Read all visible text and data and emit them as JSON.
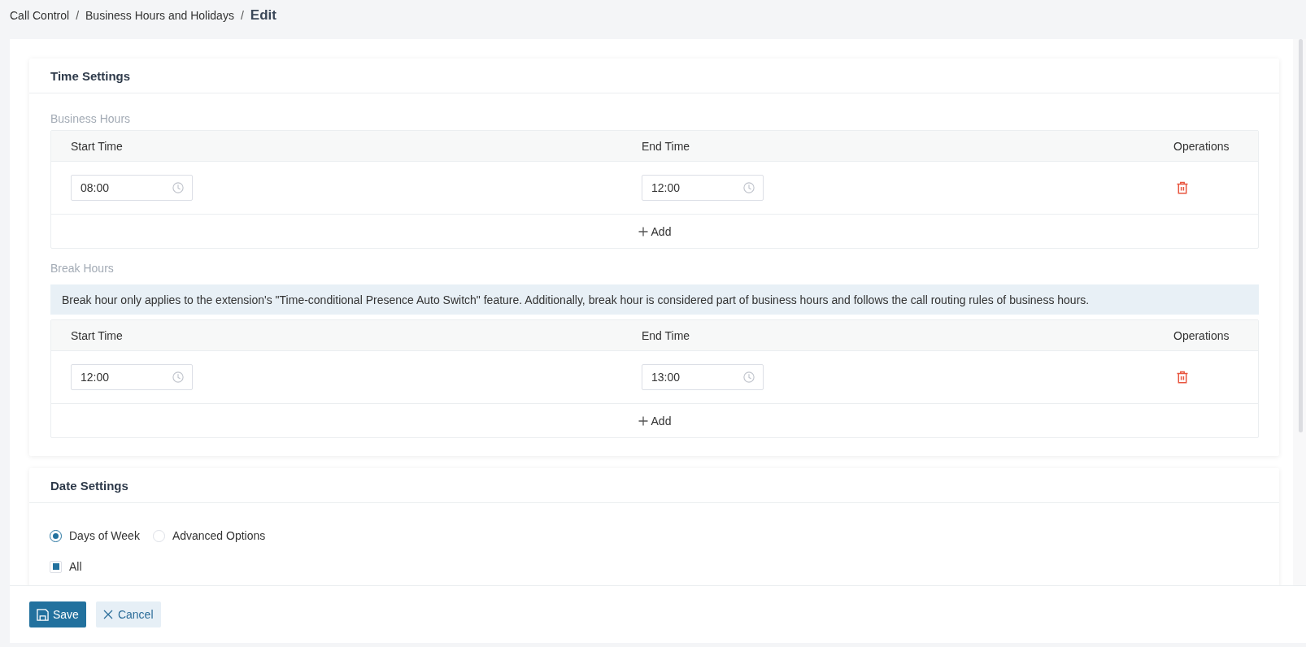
{
  "breadcrumb": [
    {
      "label": "Call Control",
      "separator": "/",
      "current": false
    },
    {
      "label": "Business Hours and Holidays",
      "separator": "/",
      "current": false
    },
    {
      "label": "Edit",
      "current": true
    }
  ],
  "time_settings": {
    "title": "Time Settings",
    "business_hours": {
      "label": "Business Hours",
      "columns": [
        "Start Time",
        "End Time",
        "Operations"
      ],
      "rows": [
        {
          "start_time": "08:00",
          "end_time": "12:00"
        }
      ],
      "add_button": "Add"
    },
    "break_hours": {
      "label": "Break Hours",
      "notice": "Break hour only applies to the extension's \"Time-conditional Presence Auto Switch\" feature. Additionally, break hour is considered part of business hours and follows the call routing rules of business hours.",
      "columns": [
        "Start Time",
        "End Time",
        "Operations"
      ],
      "rows": [
        {
          "start_time": "12:00",
          "end_time": "13:00"
        }
      ],
      "add_button": "Add"
    }
  },
  "date_settings": {
    "title": "Date Settings",
    "mode_options": [
      {
        "label": "Days of Week",
        "selected": true
      },
      {
        "label": "Advanced Options",
        "selected": false
      }
    ],
    "all_checkbox": {
      "label": "All",
      "checked": false,
      "indeterminate": true
    }
  },
  "footer": {
    "buttons": [
      {
        "label": "Save",
        "kind": "primary"
      },
      {
        "label": "Cancel",
        "kind": "secondary"
      }
    ]
  }
}
